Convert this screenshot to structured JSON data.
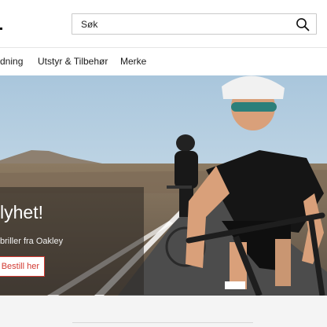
{
  "header": {
    "search": {
      "value": "Søk"
    }
  },
  "nav": {
    "items": [
      {
        "label": "dning"
      },
      {
        "label": "Utstyr & Tilbehør"
      },
      {
        "label": "Merke"
      }
    ]
  },
  "hero": {
    "title": "lyhet!",
    "subtitle": "briller fra Oakley",
    "button_label": "Bestill her"
  },
  "colors": {
    "accent": "#d23a32",
    "header_bg": "#ffffff",
    "page_bg": "#f4f4f4"
  }
}
